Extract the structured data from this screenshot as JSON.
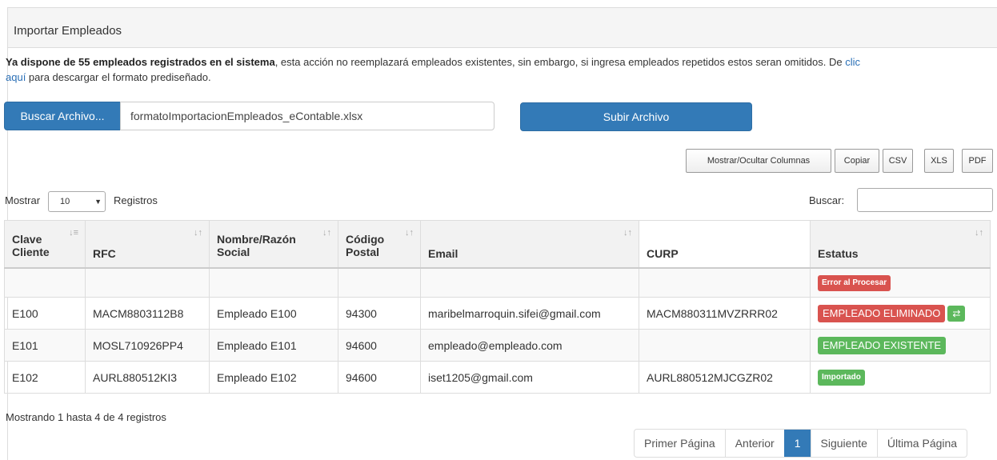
{
  "panel": {
    "title": "Importar Empleados"
  },
  "intro": {
    "bold_text": "Ya dispone de 55 empleados registrados en el sistema",
    "text": ", esta acción no reemplazará empleados existentes, sin embargo, si ingresa empleados repetidos estos seran omitidos. De ",
    "link_part1": "clic",
    "link_part2": "aquí",
    "text2": " para descargar el formato prediseñado."
  },
  "upload": {
    "browse_label": "Buscar Archivo...",
    "file_name": "formatoImportacionEmpleados_eContable.xlsx",
    "upload_label": "Subir Archivo"
  },
  "export_buttons": [
    "Mostrar/Ocultar Columnas",
    "Copiar",
    "CSV",
    "XLS",
    "PDF"
  ],
  "length": {
    "show_label": "Mostrar",
    "value": "10",
    "suffix": "Registros"
  },
  "search": {
    "label": "Buscar:",
    "value": ""
  },
  "table": {
    "headers": [
      "Clave Cliente",
      "RFC",
      "Nombre/Razón Social",
      "Código Postal",
      "Email",
      "CURP",
      "Estatus"
    ],
    "rows": [
      {
        "clave": "",
        "rfc": "",
        "nombre": "",
        "cp": "",
        "email": "",
        "curp": "",
        "status": "Error al Procesar",
        "status_type": "danger-sm"
      },
      {
        "clave": "E100",
        "rfc": "MACM8803112B8",
        "nombre": "Empleado E100",
        "cp": "94300",
        "email": "maribelmarroquin.sifei@gmail.com",
        "curp": "MACM880311MVZRRR02",
        "status": "EMPLEADO ELIMINADO",
        "status_type": "danger-big"
      },
      {
        "clave": "E101",
        "rfc": "MOSL710926PP4",
        "nombre": "Empleado E101",
        "cp": "94600",
        "email": "empleado@empleado.com",
        "curp": "",
        "status": "EMPLEADO EXISTENTE",
        "status_type": "success-big"
      },
      {
        "clave": "E102",
        "rfc": "AURL880512KI3",
        "nombre": "Empleado E102",
        "cp": "94600",
        "email": "iset1205@gmail.com",
        "curp": "AURL880512MJCGZR02",
        "status": "Importado",
        "status_type": "success-sm"
      }
    ]
  },
  "info": "Mostrando 1 hasta 4 de 4 registros",
  "pagination": {
    "first": "Primer Página",
    "prev": "Anterior",
    "current": "1",
    "next": "Siguiente",
    "last": "Última Página"
  },
  "colors": {
    "primary": "#337ab7",
    "danger": "#d9534f",
    "success": "#5cb85c",
    "link": "#2a6fb6"
  }
}
